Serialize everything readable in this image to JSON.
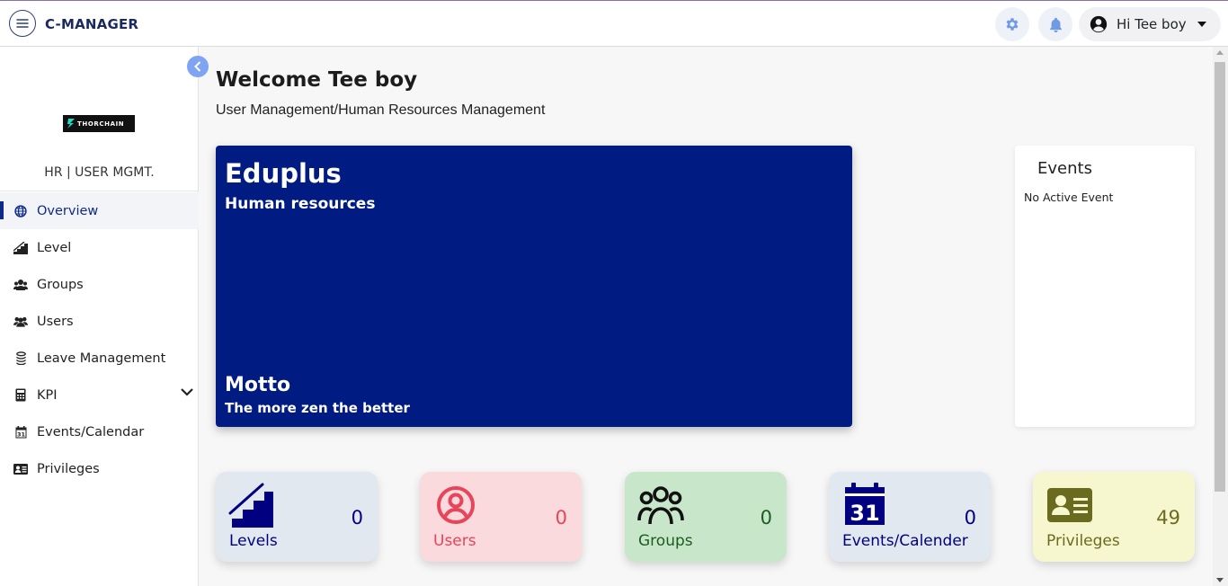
{
  "header": {
    "brand": "C-MANAGER",
    "user_greeting": "Hi Tee boy",
    "icons": [
      "menu-icon",
      "gear-icon",
      "bell-icon",
      "user-circle-icon",
      "caret-down-icon"
    ]
  },
  "sidebar": {
    "logo_text": "THORCHAIN",
    "title": "HR | USER MGMT.",
    "items": [
      {
        "label": "Overview",
        "icon": "globe-icon",
        "active": true
      },
      {
        "label": "Level",
        "icon": "stairs-icon"
      },
      {
        "label": "Groups",
        "icon": "user-group-icon"
      },
      {
        "label": "Users",
        "icon": "users-icon"
      },
      {
        "label": "Leave Management",
        "icon": "coins-icon"
      },
      {
        "label": "KPI",
        "icon": "calculator-icon",
        "has_submenu": true
      },
      {
        "label": "Events/Calendar",
        "icon": "calendar-icon"
      },
      {
        "label": "Privileges",
        "icon": "id-card-icon"
      }
    ]
  },
  "main": {
    "welcome": "Welcome Tee boy",
    "subtitle": "User Management/Human Resources Management",
    "hero": {
      "org_name": "Eduplus",
      "department": "Human resources",
      "motto_label": "Motto",
      "motto_text": "The more zen the better"
    },
    "events": {
      "title": "Events",
      "empty_text": "No Active Event"
    },
    "stats": [
      {
        "label": "Levels",
        "value": "0",
        "bg": "#e2e8f0",
        "color": "#000080",
        "icon": "stairs-icon"
      },
      {
        "label": "Users",
        "value": "0",
        "bg": "#fadadd",
        "color": "#e8445a",
        "icon": "user-circle-icon"
      },
      {
        "label": "Groups",
        "value": "0",
        "bg": "#c8e6c9",
        "color": "#1b5e20",
        "icon": "user-group-icon"
      },
      {
        "label": "Events/Calender",
        "value": "0",
        "bg": "#e2e8f0",
        "color": "#000080",
        "icon": "calendar-icon"
      },
      {
        "label": "Privileges",
        "value": "49",
        "bg": "#f7f7cf",
        "color": "#6b6b1f",
        "icon": "id-card-icon"
      }
    ]
  },
  "colors": {
    "primary": "#001c82",
    "active_nav": "#0d2a8a",
    "collapse_button": "#7fa4f4"
  }
}
